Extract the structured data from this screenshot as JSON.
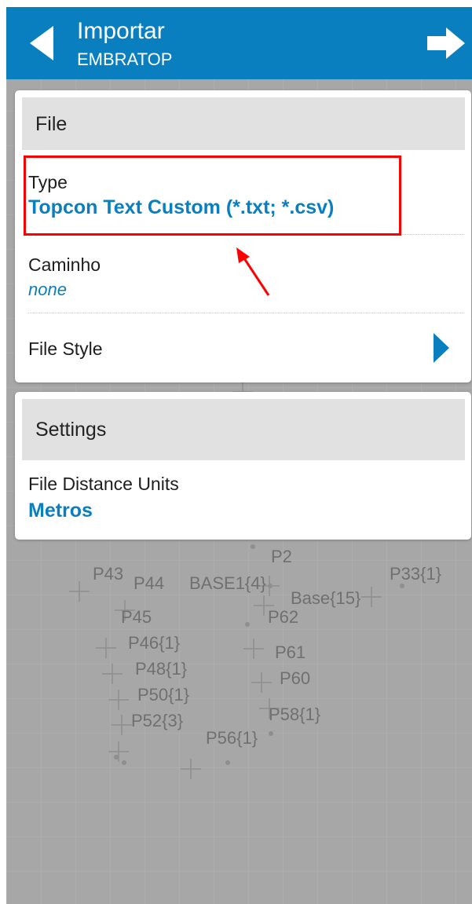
{
  "header": {
    "title": "Importar",
    "subtitle": "EMBRATOP",
    "back_icon": "back-arrow-icon",
    "next_icon": "forward-arrow-icon"
  },
  "file_section": {
    "header": "File",
    "type_label": "Type",
    "type_value": "Topcon Text Custom (*.txt; *.csv)",
    "path_label": "Caminho",
    "path_value": "none",
    "style_label": "File Style"
  },
  "settings_section": {
    "header": "Settings",
    "units_label": "File Distance Units",
    "units_value": "Metros"
  },
  "map_points": {
    "p2": "P2",
    "p43": "P43",
    "p44": "P44",
    "base1": "BASE1{4}",
    "p33": "P33{1}",
    "base15": "Base{15}",
    "p45": "P45",
    "p62": "P62",
    "p46": "P46{1}",
    "p61": "P61",
    "p48": "P48{1}",
    "p60": "P60",
    "p50": "P50{1}",
    "p58": "P58{1}",
    "p52": "P52{3}",
    "p56": "P56{1}"
  },
  "colors": {
    "header_bg": "#0a7fc0",
    "accent": "#0a7fc0",
    "map_bg": "#a7a7a7",
    "highlight": "#ff0000"
  }
}
